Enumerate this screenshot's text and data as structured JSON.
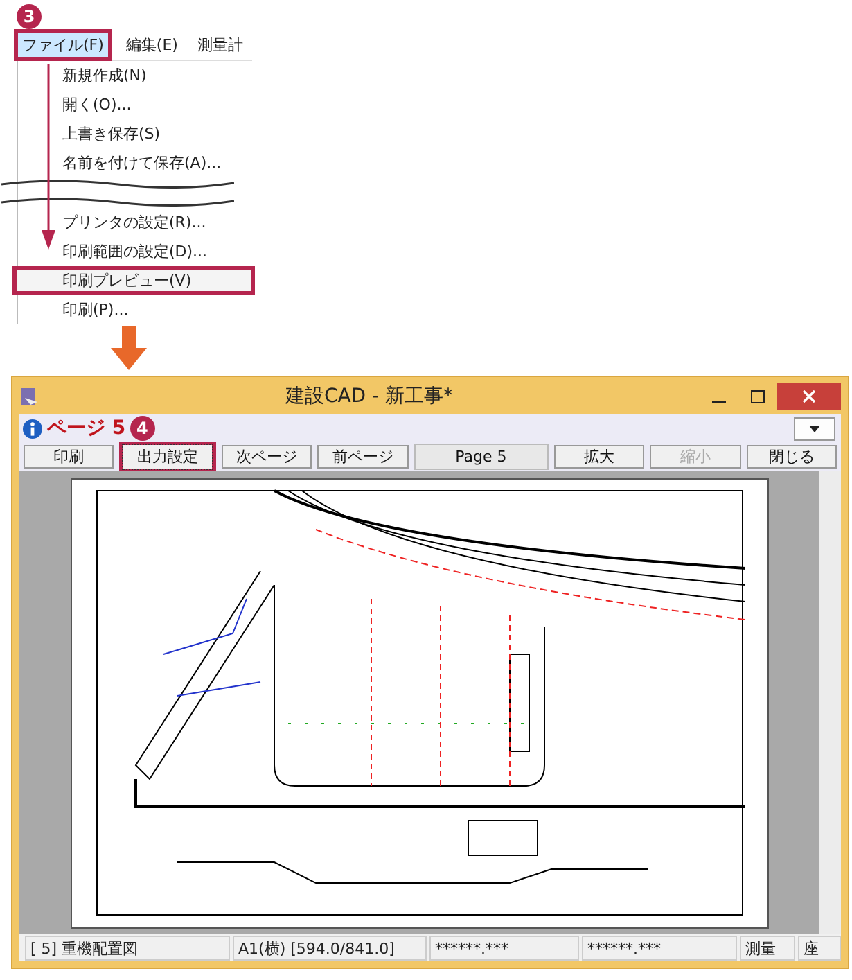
{
  "menu": {
    "step": "3",
    "bar": [
      {
        "label": "ファイル(F)",
        "selected": true
      },
      {
        "label": "編集(E)",
        "selected": false
      },
      {
        "label": "測量計",
        "selected": false
      }
    ],
    "items": [
      {
        "kind": "item",
        "label": "新規作成(N)",
        "highlighted": false
      },
      {
        "kind": "item",
        "label": "開く(O)...",
        "highlighted": false
      },
      {
        "kind": "item",
        "label": "上書き保存(S)",
        "highlighted": false
      },
      {
        "kind": "item",
        "label": "名前を付けて保存(A)...",
        "highlighted": false
      },
      {
        "kind": "break"
      },
      {
        "kind": "item",
        "label": "プリンタの設定(R)...",
        "highlighted": false
      },
      {
        "kind": "item",
        "label": "印刷範囲の設定(D)...",
        "highlighted": false
      },
      {
        "kind": "item",
        "label": "印刷プレビュー(V)",
        "highlighted": true
      },
      {
        "kind": "item",
        "label": "印刷(P)...",
        "highlighted": false
      }
    ]
  },
  "window": {
    "title": "建設CAD - 新工事*",
    "page_title": "ページ 5",
    "step": "4",
    "buttons": [
      {
        "kind": "button",
        "label": "印刷",
        "disabled": false,
        "highlighted": false
      },
      {
        "kind": "button",
        "label": "出力設定",
        "disabled": false,
        "highlighted": true
      },
      {
        "kind": "button",
        "label": "次ページ",
        "disabled": false,
        "highlighted": false
      },
      {
        "kind": "button",
        "label": "前ページ",
        "disabled": false,
        "highlighted": false
      },
      {
        "kind": "field",
        "label": "Page 5",
        "disabled": false,
        "highlighted": false
      },
      {
        "kind": "button",
        "label": "拡大",
        "disabled": false,
        "highlighted": false
      },
      {
        "kind": "button",
        "label": "縮小",
        "disabled": true,
        "highlighted": false
      },
      {
        "kind": "button",
        "label": "閉じる",
        "disabled": false,
        "highlighted": false
      }
    ],
    "status_bar": [
      "[  5] 重機配置図",
      "A1(横) [594.0/841.0]",
      "******.***",
      "******.***",
      "測量",
      "座"
    ]
  }
}
